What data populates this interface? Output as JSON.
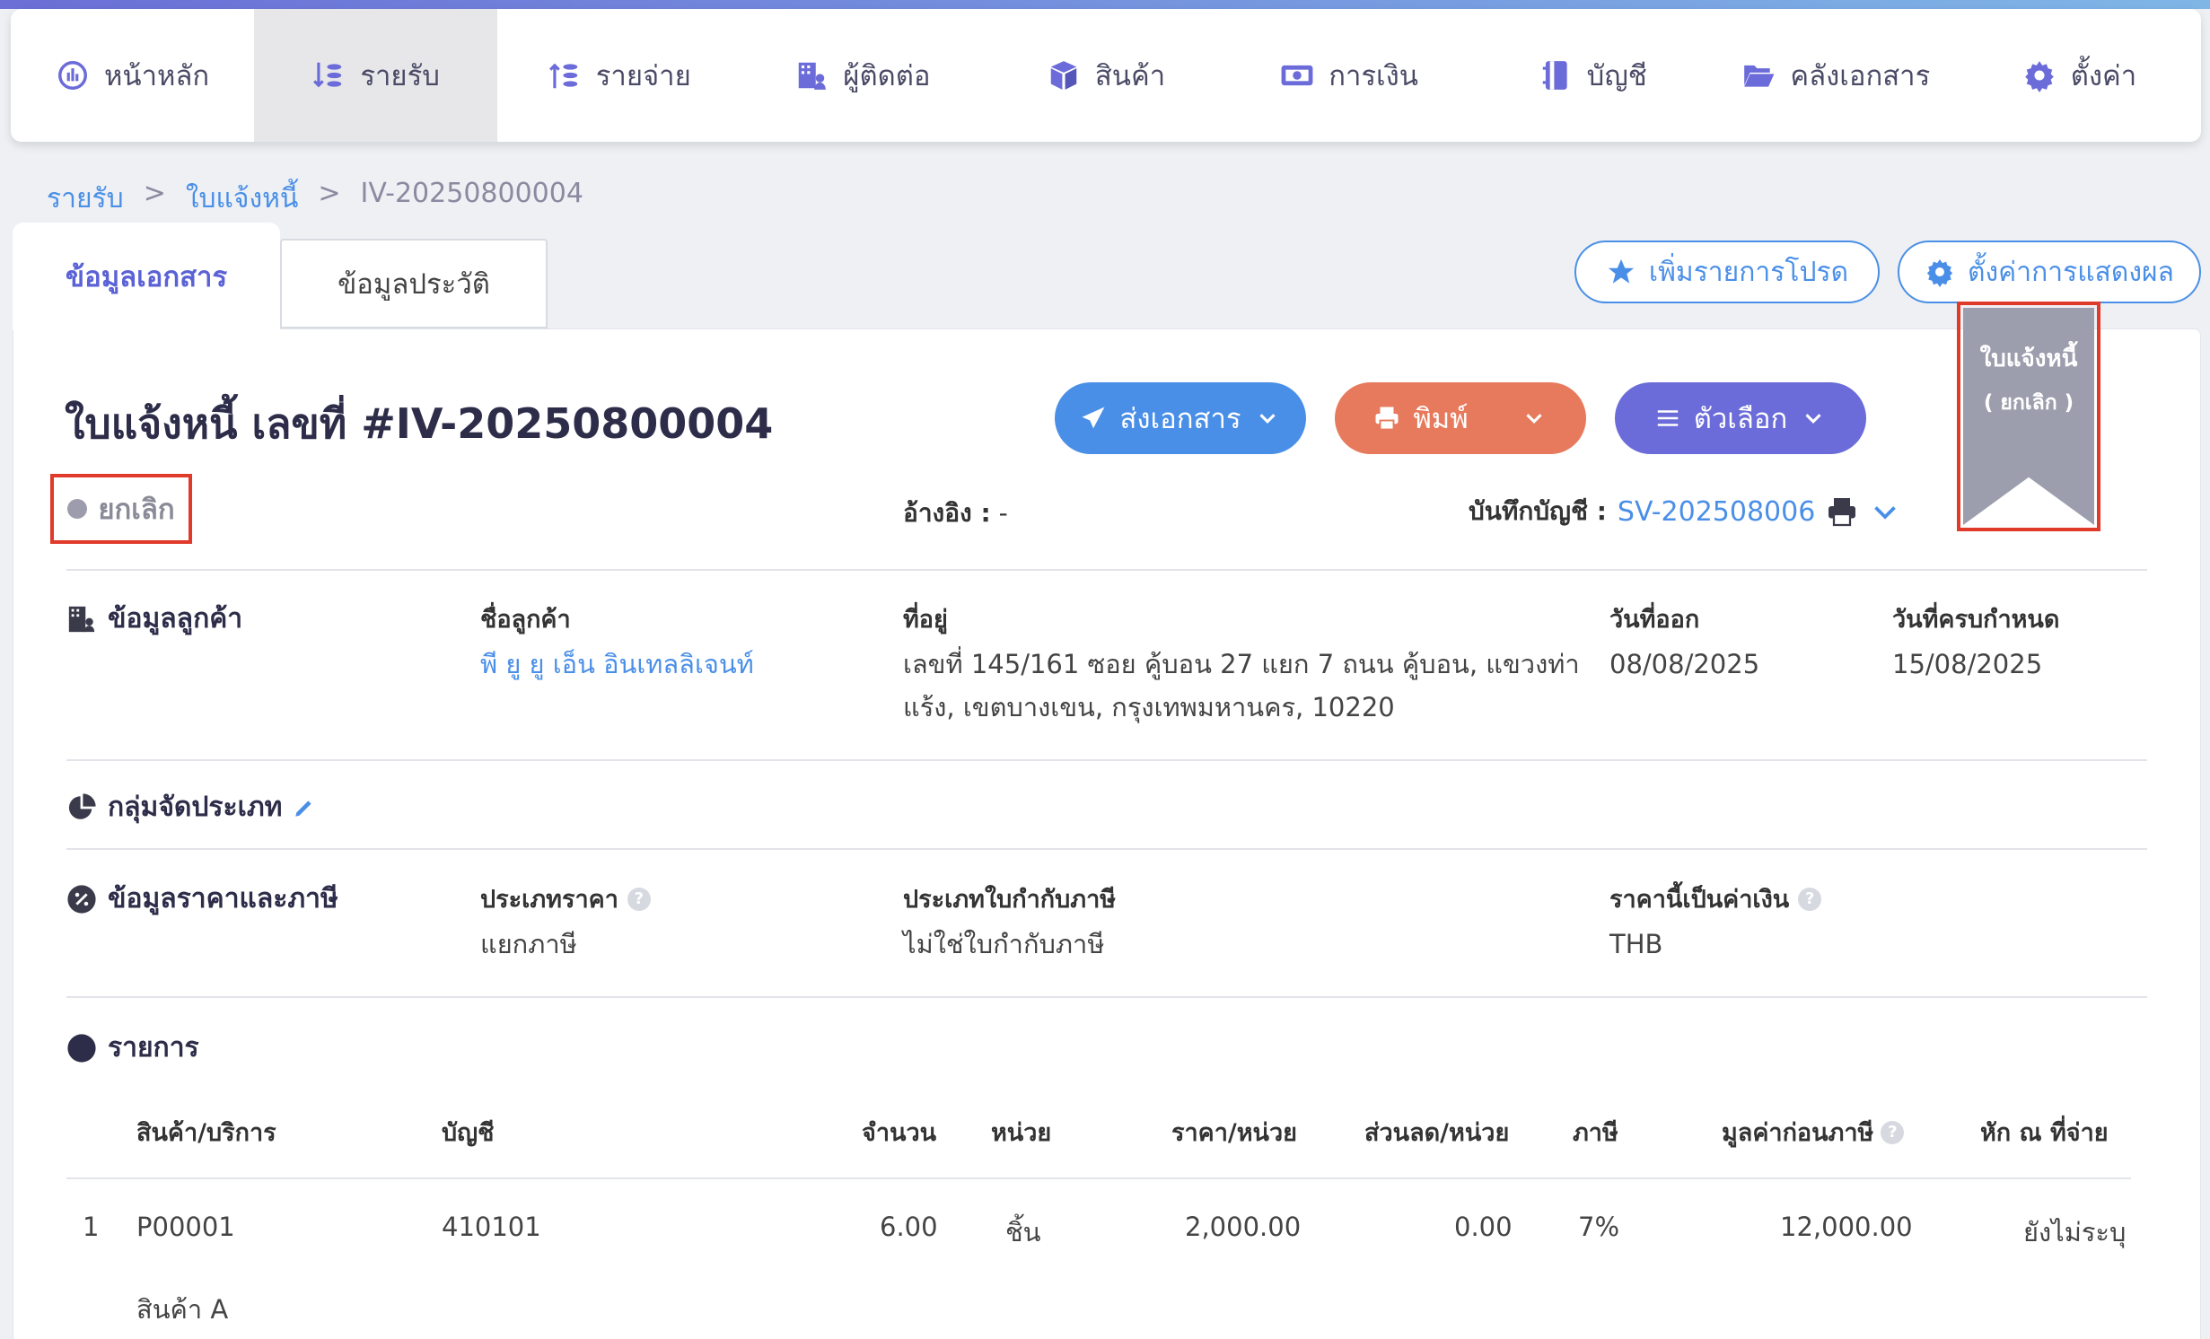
{
  "nav": {
    "items": [
      {
        "label": "หน้าหลัก",
        "icon": "dashboard-icon"
      },
      {
        "label": "รายรับ",
        "icon": "income-icon"
      },
      {
        "label": "รายจ่าย",
        "icon": "expense-icon"
      },
      {
        "label": "ผู้ติดต่อ",
        "icon": "contacts-icon"
      },
      {
        "label": "สินค้า",
        "icon": "product-icon"
      },
      {
        "label": "การเงิน",
        "icon": "money-icon"
      },
      {
        "label": "บัญชี",
        "icon": "ledger-icon"
      },
      {
        "label": "คลังเอกสาร",
        "icon": "folder-icon"
      },
      {
        "label": "ตั้งค่า",
        "icon": "gear-icon"
      }
    ]
  },
  "breadcrumb": {
    "level1": "รายรับ",
    "sep": ">",
    "level2": "ใบแจ้งหนี้",
    "current": "IV-20250800004"
  },
  "tabs": {
    "doc_info": "ข้อมูลเอกสาร",
    "history": "ข้อมูลประวัติ"
  },
  "toolbar": {
    "favorite": "เพิ่มรายการโปรด",
    "display_settings": "ตั้งค่าการแสดงผล"
  },
  "doc": {
    "title": "ใบแจ้งหนี้ เลขที่ #IV-20250800004",
    "status": "ยกเลิก",
    "ref_label": "อ้างอิง :",
    "ref_value": "-",
    "acct_label": "บันทึกบัญชี :",
    "acct_value": "SV-202508006"
  },
  "actions": {
    "send": "ส่งเอกสาร",
    "print": "พิมพ์",
    "options": "ตัวเลือก"
  },
  "ribbon": {
    "line1": "ใบแจ้งหนี้",
    "line2": "( ยกเลิก )"
  },
  "customer": {
    "section": "ข้อมูลลูกค้า",
    "name_label": "ชื่อลูกค้า",
    "name": "พี ยู ยู เอ็น อินเทลลิเจนท์",
    "address_label": "ที่อยู่",
    "address_line1": "เลขที่ 145/161 ซอย คู้บอน 27 แยก 7 ถนน คู้บอน, แขวงท่า",
    "address_line2": "แร้ง, เขตบางเขน, กรุงเทพมหานคร, 10220",
    "issue_label": "วันที่ออก",
    "issue_date": "08/08/2025",
    "due_label": "วันที่ครบกำหนด",
    "due_date": "15/08/2025"
  },
  "category": {
    "section": "กลุ่มจัดประเภท"
  },
  "pricing": {
    "section": "ข้อมูลราคาและภาษี",
    "price_type_label": "ประเภทราคา",
    "price_type": "แยกภาษี",
    "tax_invoice_label": "ประเภทใบกำกับภาษี",
    "tax_invoice": "ไม่ใช่ใบกำกับภาษี",
    "currency_label": "ราคานี้เป็นค่าเงิน",
    "currency": "THB"
  },
  "items": {
    "section": "รายการ",
    "headers": {
      "product": "สินค้า/บริการ",
      "account": "บัญชี",
      "qty": "จำนวน",
      "unit": "หน่วย",
      "price": "ราคา/หน่วย",
      "discount": "ส่วนลด/หน่วย",
      "tax": "ภาษี",
      "pretax": "มูลค่าก่อนภาษี",
      "wht": "หัก ณ ที่จ่าย"
    },
    "rows": [
      {
        "no": "1",
        "code": "P00001",
        "name": "สินค้า A",
        "account": "410101",
        "qty": "6.00",
        "unit": "ชิ้น",
        "price": "2,000.00",
        "discount": "0.00",
        "tax": "7%",
        "pretax": "12,000.00",
        "wht": "ยังไม่ระบุ"
      }
    ]
  },
  "colors": {
    "accent": "#4a8fe7",
    "print": "#e77a5c",
    "options": "#6b6bd9",
    "highlight": "#e03a2a"
  }
}
